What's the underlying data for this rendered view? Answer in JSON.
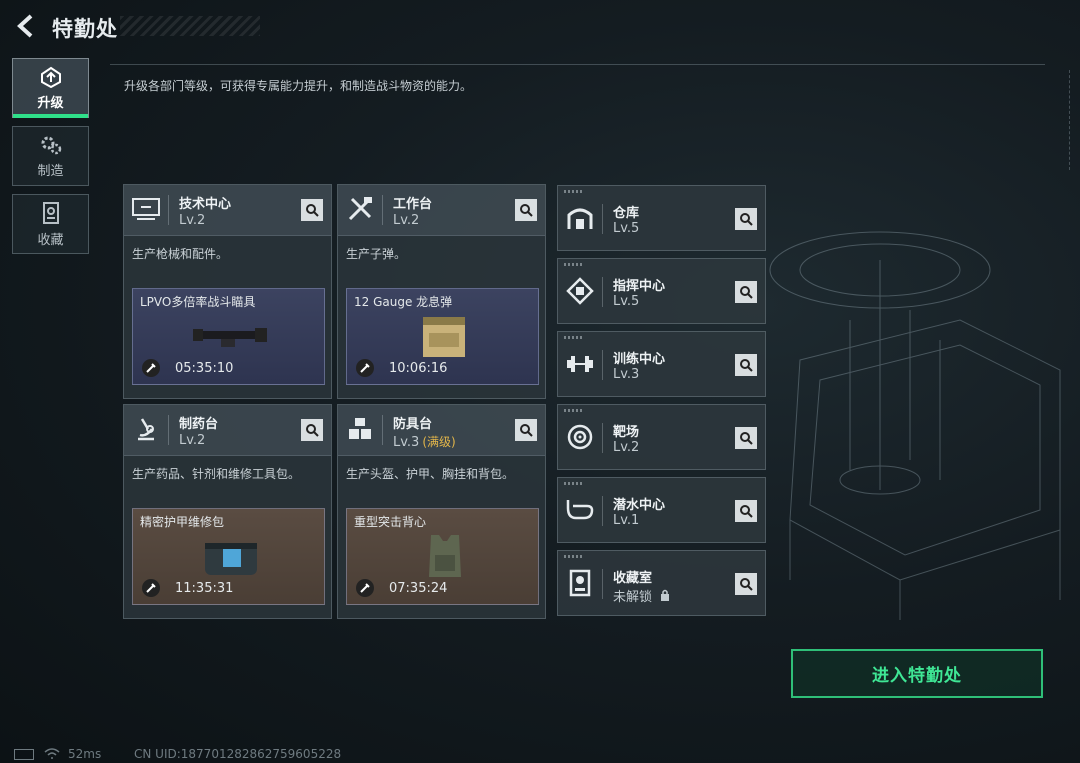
{
  "header": {
    "title": "特勤处"
  },
  "nav": [
    {
      "label": "升级",
      "icon": "upgrade-icon",
      "active": true
    },
    {
      "label": "制造",
      "icon": "gears-icon",
      "active": false
    },
    {
      "label": "收藏",
      "icon": "collection-icon",
      "active": false
    }
  ],
  "description": "升级各部门等级，可获得专属能力提升，和制造战斗物资的能力。",
  "cards": [
    {
      "name": "技术中心",
      "level": "Lv.2",
      "desc": "生产枪械和配件。",
      "product": "LPVO多倍率战斗瞄具",
      "time": "05:35:10",
      "icon": "computer-icon"
    },
    {
      "name": "工作台",
      "level": "Lv.2",
      "desc": "生产子弹。",
      "product": "12 Gauge 龙息弹",
      "time": "10:06:16",
      "icon": "tools-icon"
    },
    {
      "name": "制药台",
      "level": "Lv.2",
      "desc": "生产药品、针剂和维修工具包。",
      "product": "精密护甲维修包",
      "time": "11:35:31",
      "icon": "microscope-icon"
    },
    {
      "name": "防具台",
      "level": "Lv.3",
      "level_note": "(满级)",
      "desc": "生产头盔、护甲、胸挂和背包。",
      "product": "重型突击背心",
      "time": "07:35:24",
      "icon": "armor-icon"
    }
  ],
  "departments": [
    {
      "name": "仓库",
      "level": "Lv.5",
      "icon": "warehouse-icon"
    },
    {
      "name": "指挥中心",
      "level": "Lv.5",
      "icon": "command-icon"
    },
    {
      "name": "训练中心",
      "level": "Lv.3",
      "icon": "dumbbell-icon"
    },
    {
      "name": "靶场",
      "level": "Lv.2",
      "icon": "target-icon"
    },
    {
      "name": "潜水中心",
      "level": "Lv.1",
      "icon": "diving-mask-icon"
    },
    {
      "name": "收藏室",
      "level": "未解锁",
      "locked": true,
      "icon": "collection-room-icon"
    }
  ],
  "enter_button": "进入特勤处",
  "status": {
    "ping": "52ms",
    "uid": "CN UID:1877012828627596052​28"
  },
  "colors": {
    "accent": "#2fe08a",
    "max_level": "#e2b54a"
  }
}
